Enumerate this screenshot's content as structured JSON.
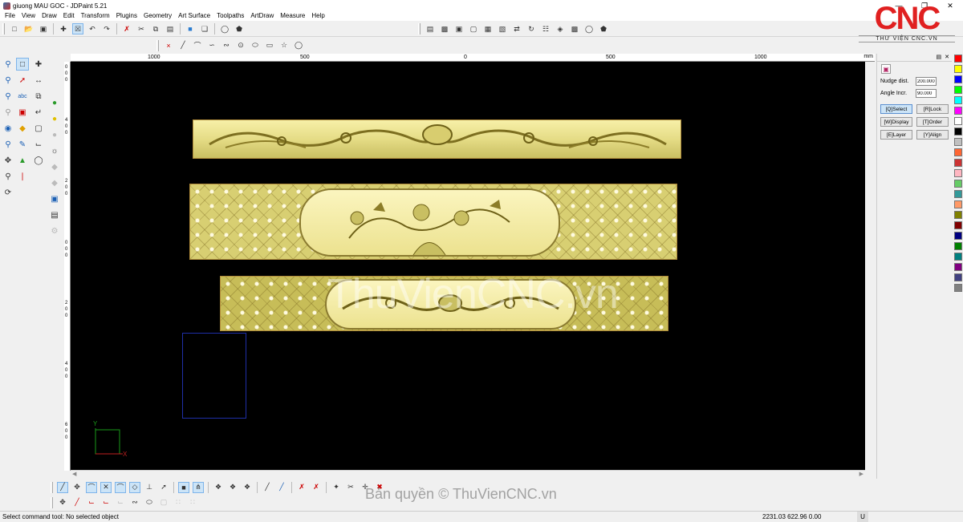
{
  "window": {
    "title": "giuong MAU GOC - JDPaint 5.21",
    "minimize": "—",
    "maximize": "❐",
    "close": "✕"
  },
  "menu": [
    "File",
    "View",
    "Draw",
    "Edit",
    "Transform",
    "Plugins",
    "Geometry",
    "Art Surface",
    "Toolpaths",
    "ArtDraw",
    "Measure",
    "Help"
  ],
  "logo": {
    "main": "CNC",
    "sub": "THƯ VIỆN CNC.VN",
    "color": "#e02020"
  },
  "ruler_top": {
    "ticks": [
      "1000",
      "500",
      "0",
      "500",
      "1000"
    ],
    "unit": "mm"
  },
  "ruler_left": {
    "ticks": [
      "0",
      "0",
      "0",
      "4",
      "0",
      "0",
      "2",
      "0",
      "0",
      "0",
      "0",
      "0",
      "2",
      "0",
      "0",
      "4",
      "0",
      "0",
      "6",
      "0",
      "0"
    ]
  },
  "canvas": {
    "background": "#000000",
    "watermark": "ThuVienCNC.vn",
    "axis_labels": {
      "y": "Y",
      "x": "X"
    }
  },
  "right_panel": {
    "nudge_label": "Nudge dist.",
    "nudge_value": "200.000",
    "angle_label": "Angle Incr.",
    "angle_value": "90.000",
    "buttons": [
      "[Q]Select",
      "[R]Lock",
      "[W]Display",
      "[T]Order",
      "[E]Layer",
      "[Y]Align"
    ]
  },
  "palette_colors": [
    "#ff0000",
    "#ffff00",
    "#0000ff",
    "#00ff00",
    "#00ffff",
    "#ff00ff",
    "#ffffff",
    "#000000",
    "#c0c0c0",
    "#ff6633",
    "#cc3333",
    "#ffb6c1",
    "#66cc66",
    "#339999",
    "#ff9966",
    "#808000",
    "#800000",
    "#000080",
    "#008000",
    "#008080",
    "#800080",
    "#404080",
    "#808080"
  ],
  "status": {
    "message": "Select command tool: No selected object",
    "coords": "2231.03 622.96 0.00",
    "unit_flag": "U"
  },
  "copyright": "Bản quyền © ThuVienCNC.vn"
}
